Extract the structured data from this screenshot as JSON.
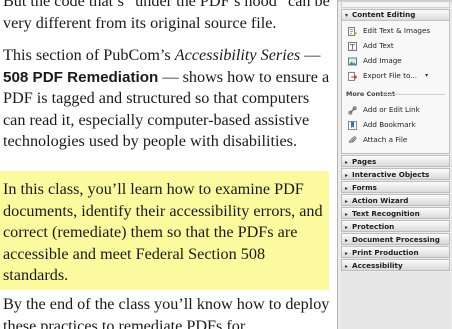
{
  "document": {
    "top_partial_text": "But the code that’s “under the PDF’s hood” can be very different from its original source file.",
    "intro_part1": "This section of PubCom’s ",
    "intro_series": "Accessibility Series",
    "intro_dash1": " — ",
    "intro_course": "508 PDF Remediation",
    "intro_part2": " — shows how to ensure a PDF is tagged and structured so that computers can read it, especially computer-based assistive technologies used by people with disabilities.",
    "highlight_text": "In this class, you’ll learn how to examine PDF documents, identify their accessibility errors, and correct (remediate) them so that the PDFs are accessible and meet Federal  Section 508 standards.",
    "end_text": "By the end of the class you’ll know how to deploy these practices to remediate PDFs for"
  },
  "pane": {
    "open_section": "Content Editing",
    "tools": [
      {
        "label": "Edit Text & Images",
        "icon": "edit-text-images-icon"
      },
      {
        "label": "Add Text",
        "icon": "add-text-icon"
      },
      {
        "label": "Add Image",
        "icon": "add-image-icon"
      },
      {
        "label": "Export File to...",
        "icon": "export-file-icon"
      }
    ],
    "more_content_label": "More Content",
    "more_tools": [
      {
        "label": "Add or Edit Link",
        "icon": "link-icon"
      },
      {
        "label": "Add Bookmark",
        "icon": "bookmark-icon"
      },
      {
        "label": "Attach a File",
        "icon": "attach-file-icon"
      }
    ],
    "collapsed_sections": [
      "Pages",
      "Interactive Objects",
      "Forms",
      "Action Wizard",
      "Text Recognition",
      "Protection",
      "Document Processing",
      "Print Production",
      "Accessibility"
    ],
    "colors": {
      "highlight": "#fbfa9e",
      "pane_bg": "#ebebeb"
    }
  }
}
